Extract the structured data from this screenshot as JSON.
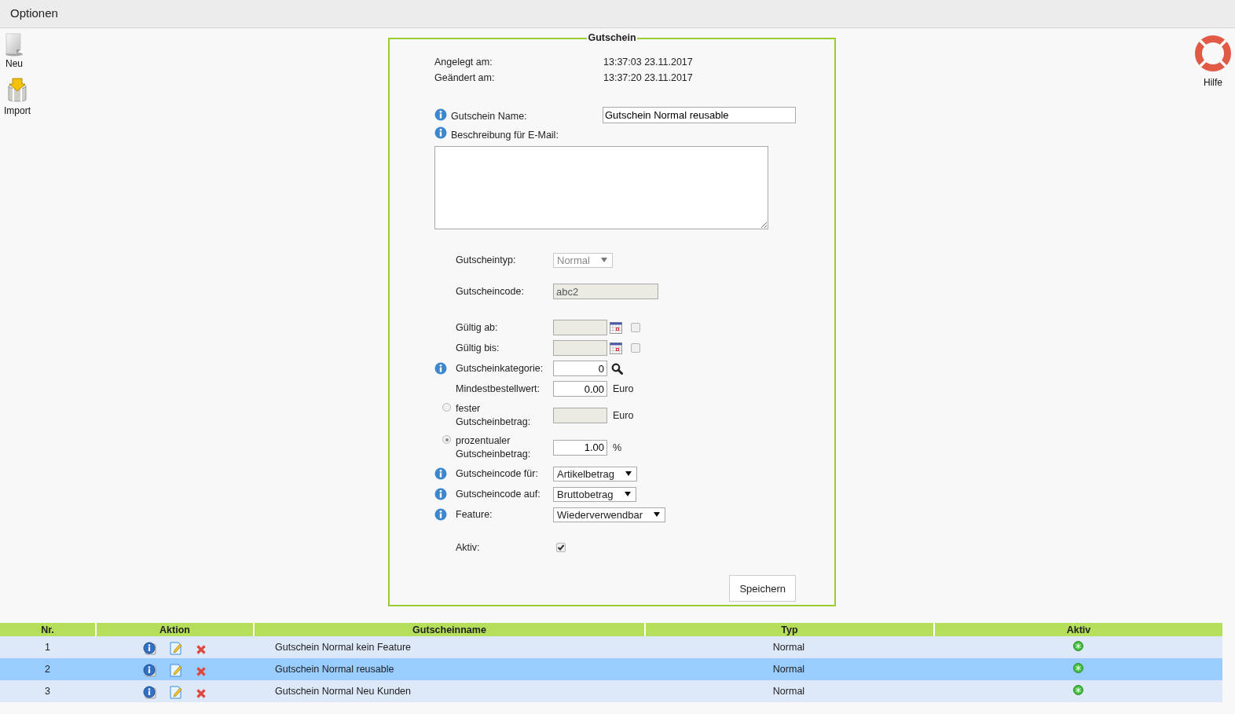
{
  "header": {
    "title": "Optionen"
  },
  "toolbar": [
    {
      "kind": "new",
      "label": "Neu"
    },
    {
      "kind": "import",
      "label": "Import"
    }
  ],
  "help": {
    "label": "Hilfe"
  },
  "form": {
    "legend": "Gutschein",
    "meta": [
      {
        "label": "Angelegt am:",
        "value": "13:37:03 23.11.2017"
      },
      {
        "label": "Geändert am:",
        "value": "13:37:20 23.11.2017"
      }
    ],
    "name_field": {
      "label": "Gutschein Name:",
      "value": "Gutschein Normal reusable",
      "info": true
    },
    "description": {
      "label": "Beschreibung für E-Mail:",
      "info": true
    },
    "groups": [
      {
        "fields": [
          {
            "kind": "select",
            "label": "Gutscheintyp:",
            "value": "Normal",
            "disabled": true,
            "info": false
          }
        ]
      },
      {
        "fields": [
          {
            "kind": "text",
            "label": "Gutscheincode:",
            "value": "abc2",
            "disabled": true,
            "info": false
          }
        ]
      },
      {
        "fields": [
          {
            "kind": "date",
            "label": "Gültig ab:",
            "disabled": true,
            "checked": false,
            "info": false
          },
          {
            "kind": "date",
            "label": "Gültig bis:",
            "disabled": true,
            "checked": false,
            "info": false
          },
          {
            "kind": "lookup",
            "label": "Gutscheinkategorie:",
            "value": "0",
            "info": true
          },
          {
            "kind": "number",
            "label": "Mindestbestellwert:",
            "value": "0.00",
            "unit": "Euro",
            "info": false
          },
          {
            "kind": "radio",
            "label": "fester Gutscheinbetrag:",
            "disabled": true,
            "unit": "Euro",
            "selected": false,
            "info": false
          },
          {
            "kind": "radio",
            "label": "prozentualer Gutscheinbetrag:",
            "value": "1.00",
            "unit": "%",
            "selected": true,
            "info": false
          },
          {
            "kind": "select",
            "label": "Gutscheincode für:",
            "value": "Artikelbetrag",
            "disabled": false,
            "info": true
          },
          {
            "kind": "select",
            "label": "Gutscheincode auf:",
            "value": "Bruttobetrag",
            "disabled": false,
            "info": true
          },
          {
            "kind": "select",
            "label": "Feature:",
            "value": "Wiederverwendbar",
            "disabled": false,
            "info": true
          }
        ]
      },
      {
        "fields": [
          {
            "kind": "checkbox",
            "label": "Aktiv:",
            "checked": true,
            "info": false
          }
        ]
      }
    ],
    "save_button": "Speichern"
  },
  "table": {
    "columns": [
      "Nr.",
      "Aktion",
      "Gutscheinname",
      "Typ",
      "Aktiv"
    ],
    "rows": [
      {
        "nr": "1",
        "name": "Gutschein Normal kein Feature",
        "type": "Normal",
        "active": true,
        "selected": false
      },
      {
        "nr": "2",
        "name": "Gutschein Normal reusable",
        "type": "Normal",
        "active": true,
        "selected": true
      },
      {
        "nr": "3",
        "name": "Gutschein Normal Neu Kunden",
        "type": "Normal",
        "active": true,
        "selected": false
      }
    ]
  }
}
